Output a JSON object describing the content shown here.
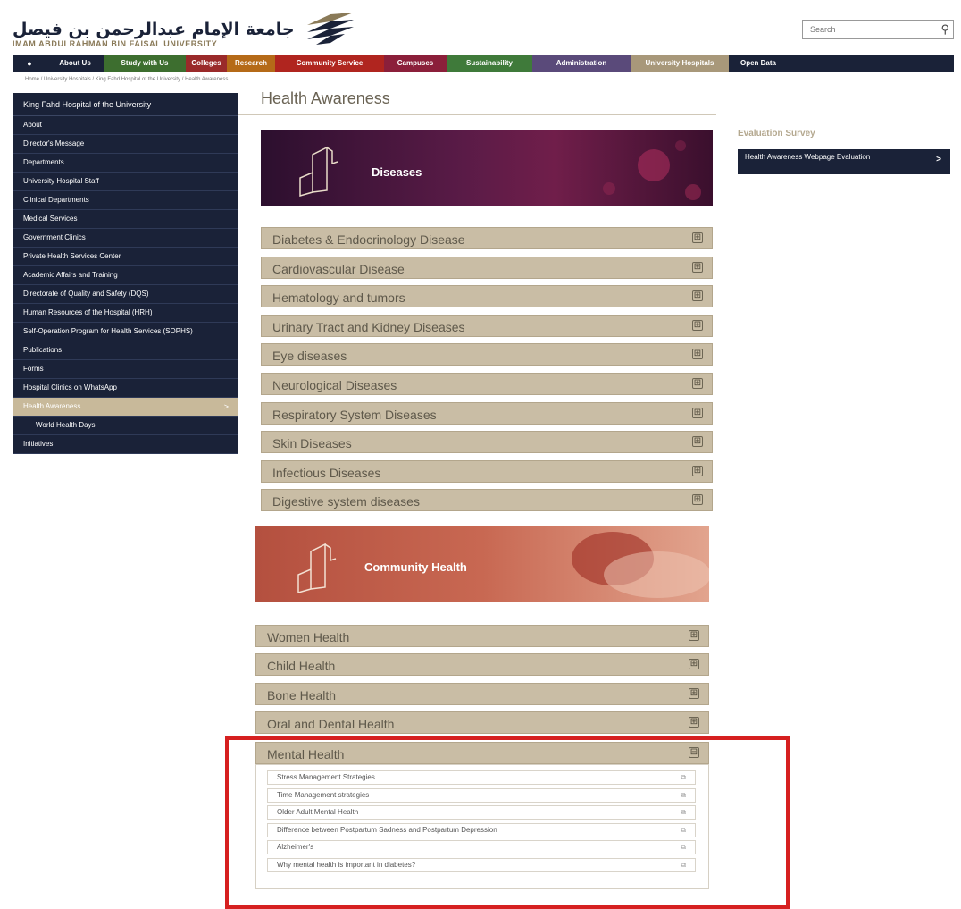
{
  "header": {
    "logo_arabic": "جامعة الإمام عبدالرحمن بن فيصل",
    "logo_english": "IMAM ABDULRAHMAN BIN FAISAL UNIVERSITY",
    "search_placeholder": "Search",
    "search_icon": "magnifier"
  },
  "nav": {
    "home_icon": "●",
    "items": [
      {
        "label": "About Us",
        "color": "#1a2238"
      },
      {
        "label": "Study with Us",
        "color": "#3d6e2f"
      },
      {
        "label": "Colleges",
        "color": "#9a2a2a"
      },
      {
        "label": "Research",
        "color": "#b56a18"
      },
      {
        "label": "Community Service",
        "color": "#b0251f"
      },
      {
        "label": "Campuses",
        "color": "#8b1f3a"
      },
      {
        "label": "Sustainability",
        "color": "#3f7a3a"
      },
      {
        "label": "Administration",
        "color": "#5a4a7a"
      },
      {
        "label": "University Hospitals",
        "color": "#a8987a"
      },
      {
        "label": "Open Data",
        "color": "#1a2238"
      }
    ]
  },
  "breadcrumb": "Home  /  University Hospitals  /  King Fahd Hospital of the University  /  Health Awareness",
  "sidebar": {
    "header": "King Fahd Hospital of the University",
    "items": [
      {
        "label": "About"
      },
      {
        "label": "Director's Message"
      },
      {
        "label": "Departments"
      },
      {
        "label": "University Hospital Staff"
      },
      {
        "label": "Clinical Departments"
      },
      {
        "label": "Medical Services"
      },
      {
        "label": "Government Clinics"
      },
      {
        "label": "Private Health Services Center"
      },
      {
        "label": "Academic Affairs and Training"
      },
      {
        "label": "Directorate of Quality and Safety (DQS)"
      },
      {
        "label": "Human Resources of the Hospital (HRH)"
      },
      {
        "label": "Self-Operation Program for Health Services (SOPHS)"
      },
      {
        "label": "Publications"
      },
      {
        "label": "Forms"
      },
      {
        "label": "Hospital Clinics on WhatsApp"
      },
      {
        "label": "Health Awareness",
        "arrow": ">"
      },
      {
        "label": "World Health Days"
      },
      {
        "label": "Initiatives"
      }
    ]
  },
  "main": {
    "title": "Health Awareness",
    "diseases_banner": "Diseases",
    "diseases": [
      "Diabetes & Endocrinology Disease",
      "Cardiovascular Disease",
      "Hematology and tumors",
      "Urinary Tract and Kidney Diseases",
      "Eye diseases",
      "Neurological Diseases",
      "Respiratory System Diseases",
      "Skin Diseases",
      "Infectious Diseases",
      "Digestive system diseases"
    ],
    "community_banner": "Community Health",
    "community": [
      "Women Health",
      "Child Health",
      "Bone Health",
      "Oral and Dental Health"
    ],
    "mental": {
      "label": "Mental Health",
      "expanded_symbol": "⊟",
      "links": [
        "Stress Management Strategies",
        "Time Management strategies",
        "Older Adult Mental Health",
        "Difference between Postpartum Sadness and Postpartum Depression",
        "Alzheimer's",
        "Why mental health is important in diabetes?"
      ]
    },
    "collapsed_symbol": "⊞",
    "link_icon": "⧉"
  },
  "right": {
    "title": "Evaluation Survey",
    "link": "Health Awareness Webpage Evaluation",
    "arrow": ">"
  },
  "colors": {
    "navy": "#1a2238",
    "beige": "#c9bda5",
    "highlight": "#d62020"
  }
}
